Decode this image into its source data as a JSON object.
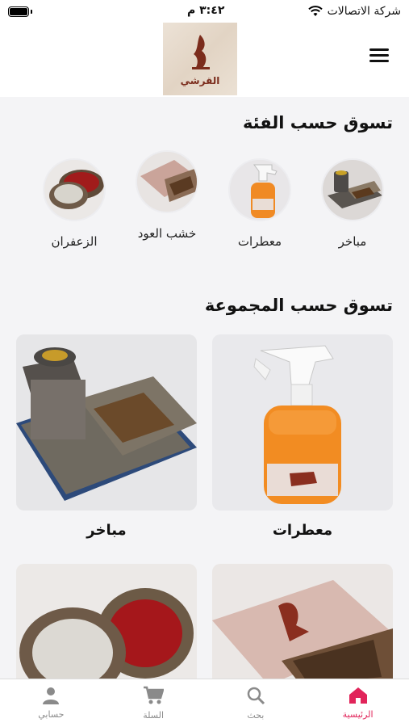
{
  "status": {
    "carrier": "شركة الاتصالات",
    "time": "٣:٤٢ م"
  },
  "header": {
    "logo_text": "القرشي",
    "menu_icon": "hamburger-icon"
  },
  "categories": {
    "title": "تسوق حسب الفئة",
    "items": [
      {
        "label": "مباخر",
        "icon": "incense-burner-image"
      },
      {
        "label": "معطرات",
        "icon": "air-freshener-image"
      },
      {
        "label": "خشب العود",
        "icon": "oud-wood-image"
      },
      {
        "label": "الزعفران",
        "icon": "saffron-image"
      }
    ]
  },
  "collections": {
    "title": "تسوق حسب المجموعة",
    "items": [
      {
        "label": "معطرات"
      },
      {
        "label": "مباخر"
      },
      {
        "label": ""
      },
      {
        "label": ""
      }
    ]
  },
  "tabs": [
    {
      "label": "الرئيسية",
      "icon": "home-icon",
      "active": true
    },
    {
      "label": "بحث",
      "icon": "search-icon",
      "active": false
    },
    {
      "label": "السلة",
      "icon": "cart-icon",
      "active": false
    },
    {
      "label": "حسابي",
      "icon": "person-icon",
      "active": false
    }
  ],
  "colors": {
    "accent": "#e1245a",
    "brand": "#7b2c1c",
    "background": "#f4f4f6"
  }
}
